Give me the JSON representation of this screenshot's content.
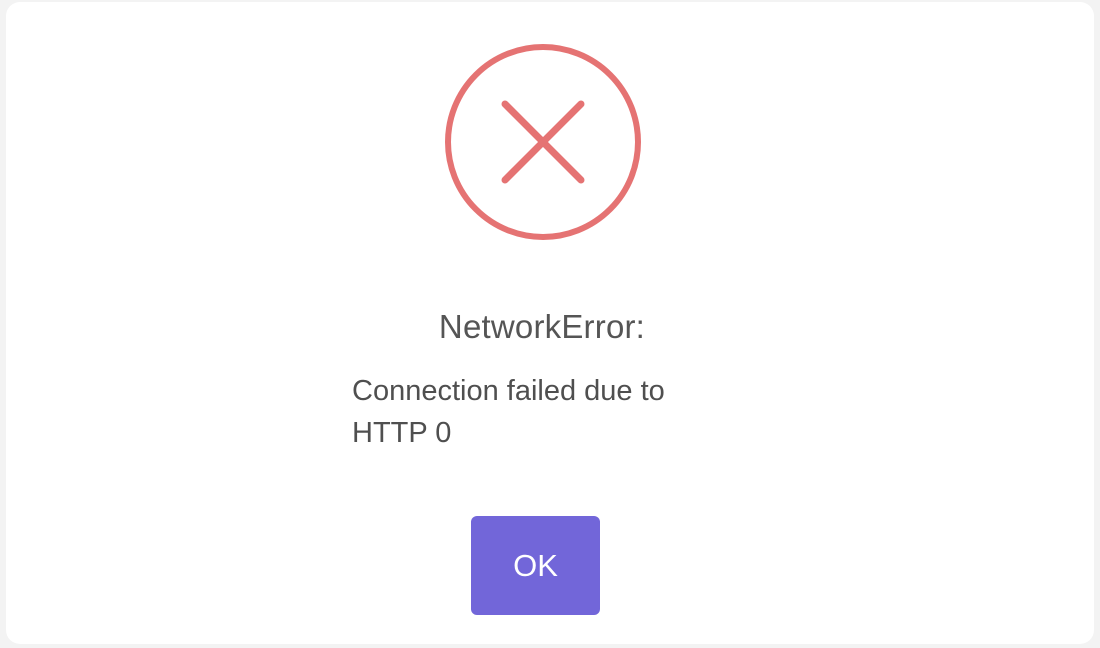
{
  "dialog": {
    "icon": "error-x-circle-icon",
    "icon_color": "#e57373",
    "title": "NetworkError:",
    "message": "Connection failed due to\nHTTP 0",
    "ok_label": "OK",
    "button_color": "#7266d9"
  }
}
